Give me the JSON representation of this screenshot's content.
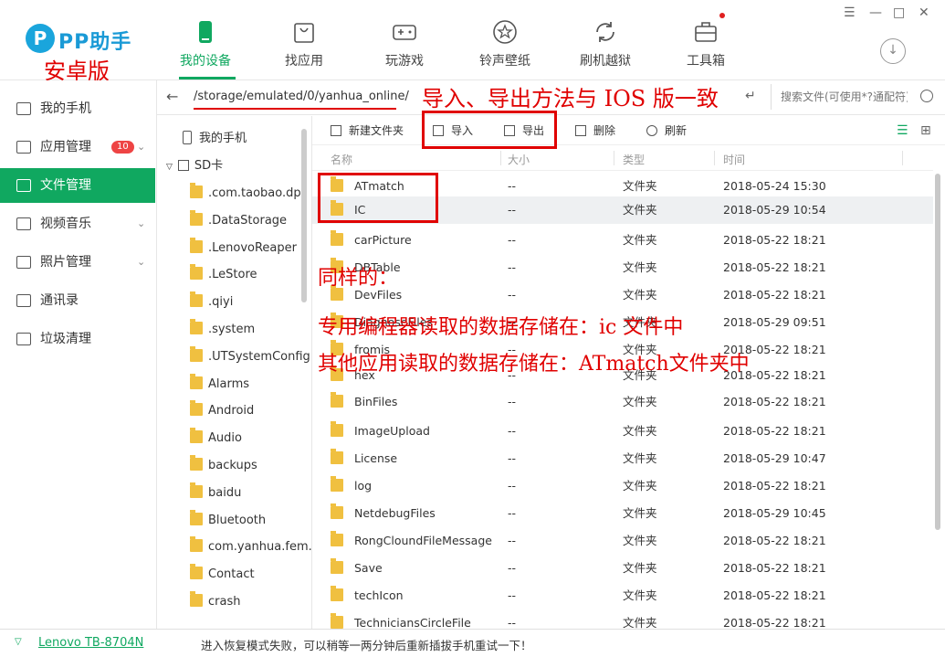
{
  "app": {
    "logo_letter": "P",
    "name": "PP助手",
    "edition": "安卓版"
  },
  "nav": [
    {
      "label": "我的设备",
      "icon": "phone-icon",
      "active": true
    },
    {
      "label": "找应用",
      "icon": "shopping-bag-icon",
      "active": false
    },
    {
      "label": "玩游戏",
      "icon": "gamepad-icon",
      "active": false
    },
    {
      "label": "铃声壁纸",
      "icon": "star-icon",
      "active": false
    },
    {
      "label": "刷机越狱",
      "icon": "refresh-cycle-icon",
      "active": false
    },
    {
      "label": "工具箱",
      "icon": "toolbox-icon",
      "active": false
    }
  ],
  "window": {
    "minimize": "—",
    "restore": "☐",
    "maximize": "□",
    "close": "✕",
    "menu": "☰",
    "download": "↓"
  },
  "sidebar": [
    {
      "label": "我的手机",
      "icon": "phone-icon"
    },
    {
      "label": "应用管理",
      "icon": "apps-icon",
      "badge": "10"
    },
    {
      "label": "文件管理",
      "icon": "folder-icon",
      "active": true
    },
    {
      "label": "视频音乐",
      "icon": "play-icon"
    },
    {
      "label": "照片管理",
      "icon": "photo-icon"
    },
    {
      "label": "通讯录",
      "icon": "contacts-icon"
    },
    {
      "label": "垃圾清理",
      "icon": "trash-icon"
    }
  ],
  "path": {
    "value": "/storage/emulated/0/yanhua_online/",
    "search_placeholder": "搜索文件(可使用*?通配符)"
  },
  "tree": {
    "root": "我的手机",
    "sd": "SD卡",
    "items": [
      ".com.taobao.dp",
      ".DataStorage",
      ".LenovoReaper",
      ".LeStore",
      ".qiyi",
      ".system",
      ".UTSystemConfig",
      "Alarms",
      "Android",
      "Audio",
      "backups",
      "baidu",
      "Bluetooth",
      "com.yanhua.fem...",
      "Contact",
      "crash"
    ]
  },
  "toolbar": {
    "new_folder": "新建文件夹",
    "import": "导入",
    "export": "导出",
    "delete": "删除",
    "refresh": "刷新"
  },
  "columns": {
    "name": "名称",
    "size": "大小",
    "type": "类型",
    "time": "时间"
  },
  "files": [
    {
      "name": "ATmatch",
      "size": "--",
      "type": "文件夹",
      "time": "2018-05-24 15:30"
    },
    {
      "name": "IC",
      "size": "--",
      "type": "文件夹",
      "time": "2018-05-29 10:54"
    },
    {
      "name": "carPicture",
      "size": "--",
      "type": "文件夹",
      "time": "2018-05-22 18:21"
    },
    {
      "name": "DBTable",
      "size": "--",
      "type": "文件夹",
      "time": "2018-05-22 18:21"
    },
    {
      "name": "DevFiles",
      "size": "--",
      "type": "文件夹",
      "time": "2018-05-22 18:21"
    },
    {
      "name": "DiagnoseFiles",
      "size": "--",
      "type": "文件夹",
      "time": "2018-05-29 09:51"
    },
    {
      "name": "fromis",
      "size": "--",
      "type": "文件夹",
      "time": "2018-05-22 18:21"
    },
    {
      "name": "hex",
      "size": "--",
      "type": "文件夹",
      "time": "2018-05-22 18:21"
    },
    {
      "name": "BinFiles",
      "size": "--",
      "type": "文件夹",
      "time": "2018-05-22 18:21"
    },
    {
      "name": "ImageUpload",
      "size": "--",
      "type": "文件夹",
      "time": "2018-05-22 18:21"
    },
    {
      "name": "License",
      "size": "--",
      "type": "文件夹",
      "time": "2018-05-29 10:47"
    },
    {
      "name": "log",
      "size": "--",
      "type": "文件夹",
      "time": "2018-05-22 18:21"
    },
    {
      "name": "NetdebugFiles",
      "size": "--",
      "type": "文件夹",
      "time": "2018-05-29 10:45"
    },
    {
      "name": "RongCloundFileMessage",
      "size": "--",
      "type": "文件夹",
      "time": "2018-05-22 18:21"
    },
    {
      "name": "Save",
      "size": "--",
      "type": "文件夹",
      "time": "2018-05-22 18:21"
    },
    {
      "name": "techIcon",
      "size": "--",
      "type": "文件夹",
      "time": "2018-05-22 18:21"
    },
    {
      "name": "TechniciansCircleFile",
      "size": "--",
      "type": "文件夹",
      "time": "2018-05-22 18:21"
    }
  ],
  "status": {
    "device": "Lenovo TB-8704N",
    "message": "进入恢复模式失败，可以稍等一两分钟后重新插拔手机重试一下！"
  },
  "annotations": {
    "title": "导入、导出方法与 IOS 版一致",
    "line1": "同样的：",
    "line2": "专用编程器读取的数据存储在：ic 文件中",
    "line3": "其他应用读取的数据存储在：ATmatch文件夹中"
  },
  "colors": {
    "accent": "#10a860",
    "annotation": "#e00000",
    "brand": "#1a9ad6"
  }
}
